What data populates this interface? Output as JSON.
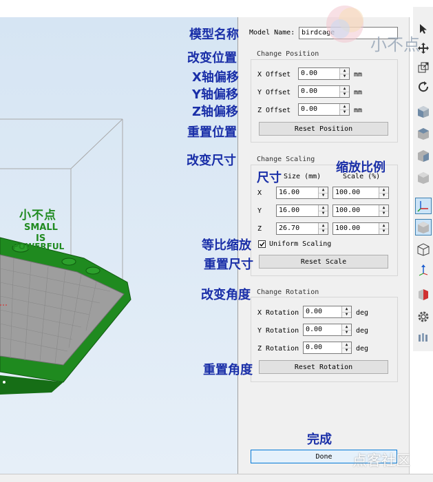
{
  "annotations": {
    "model_name": "模型名称",
    "change_position": "改变位置",
    "x_offset": "X轴偏移",
    "y_offset": "Y轴偏移",
    "z_offset": "Z轴偏移",
    "reset_position": "重置位置",
    "change_size": "改变尺寸",
    "size": "尺寸",
    "scale_ratio": "缩放比例",
    "uniform_scaling": "等比缩放",
    "reset_size": "重置尺寸",
    "change_angle": "改变角度",
    "reset_angle": "重置角度",
    "done": "完成"
  },
  "model": {
    "label": "Model Name:",
    "value": "birdcage"
  },
  "position": {
    "title": "Change Position",
    "rows": [
      {
        "label": "X Offset",
        "value": "0.00",
        "unit": "mm"
      },
      {
        "label": "Y Offset",
        "value": "0.00",
        "unit": "mm"
      },
      {
        "label": "Z Offset",
        "value": "0.00",
        "unit": "mm"
      }
    ],
    "reset_label": "Reset Position"
  },
  "scaling": {
    "title": "Change Scaling",
    "size_header": "Size (mm)",
    "scale_header": "Scale (%)",
    "rows": [
      {
        "axis": "X",
        "size": "16.00",
        "scale": "100.00"
      },
      {
        "axis": "Y",
        "size": "16.00",
        "scale": "100.00"
      },
      {
        "axis": "Z",
        "size": "26.70",
        "scale": "100.00"
      }
    ],
    "uniform_label": "Uniform Scaling",
    "uniform_checked": true,
    "reset_label": "Reset Scale"
  },
  "rotation": {
    "title": "Change Rotation",
    "rows": [
      {
        "label": "X Rotation",
        "value": "0.00",
        "unit": "deg"
      },
      {
        "label": "Y Rotation",
        "value": "0.00",
        "unit": "deg"
      },
      {
        "label": "Z Rotation",
        "value": "0.00",
        "unit": "deg"
      }
    ],
    "reset_label": "Reset Rotation"
  },
  "done_label": "Done",
  "viewport": {
    "model_text": [
      "小不点",
      "SMALL",
      "IS",
      "POWERFUL"
    ]
  },
  "watermarks": {
    "top_right": "小不点",
    "bottom_right": "点客社区"
  },
  "toolbar_icons": [
    "select-arrow-icon",
    "move-icon",
    "scale-icon",
    "rotate-icon",
    "view-cube-front-icon",
    "view-cube-top-icon",
    "view-cube-side-icon",
    "view-cube-iso-icon",
    "axis-icon",
    "view-cube-selected-icon",
    "wireframe-cube-icon",
    "z-axis-icon",
    "section-icon",
    "settings-gear-icon",
    "support-icon"
  ],
  "colors": {
    "annotation": "#1a2fa8",
    "model_green": "#1f8a1f",
    "bed_gray": "#9e9e9e",
    "viewport_bg": "#d6e5f3",
    "done_border": "#0078d7"
  }
}
